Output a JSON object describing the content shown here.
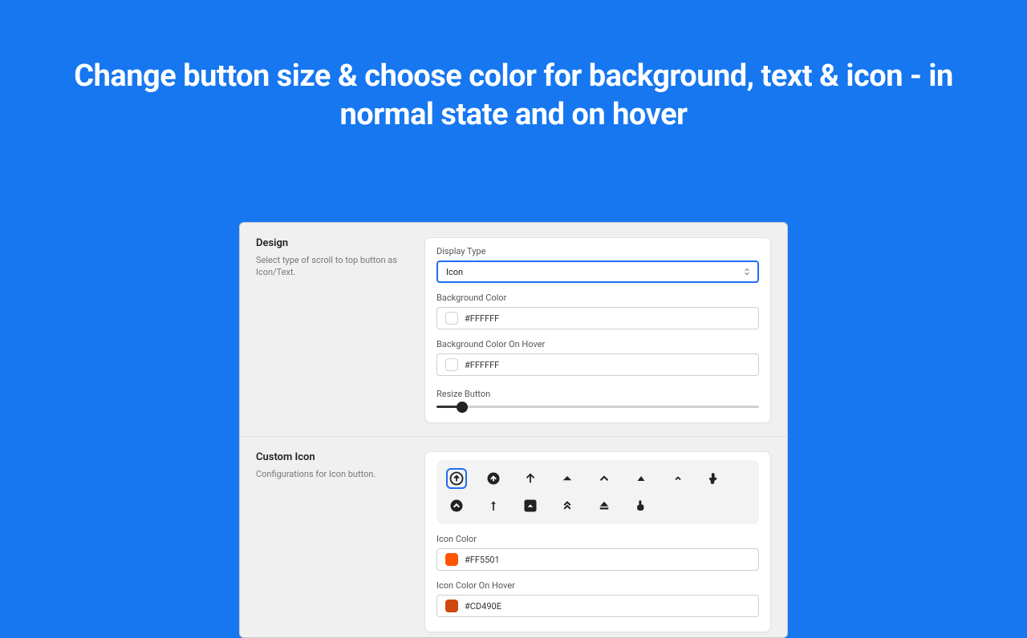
{
  "headline": "Change button size & choose color for background, text & icon - in normal state and on hover",
  "sections": {
    "design": {
      "title": "Design",
      "desc": "Select type of scroll to top button as Icon/Text.",
      "display_type_label": "Display Type",
      "display_type_value": "Icon",
      "bg_label": "Background Color",
      "bg_value": "#FFFFFF",
      "bg_hover_label": "Background Color On Hover",
      "bg_hover_value": "#FFFFFF",
      "resize_label": "Resize Button"
    },
    "custom_icon": {
      "title": "Custom Icon",
      "desc": "Configurations for Icon button.",
      "icon_color_label": "Icon Color",
      "icon_color_value": "#FF5501",
      "icon_hover_label": "Icon Color On Hover",
      "icon_hover_value": "#CD490E"
    }
  }
}
